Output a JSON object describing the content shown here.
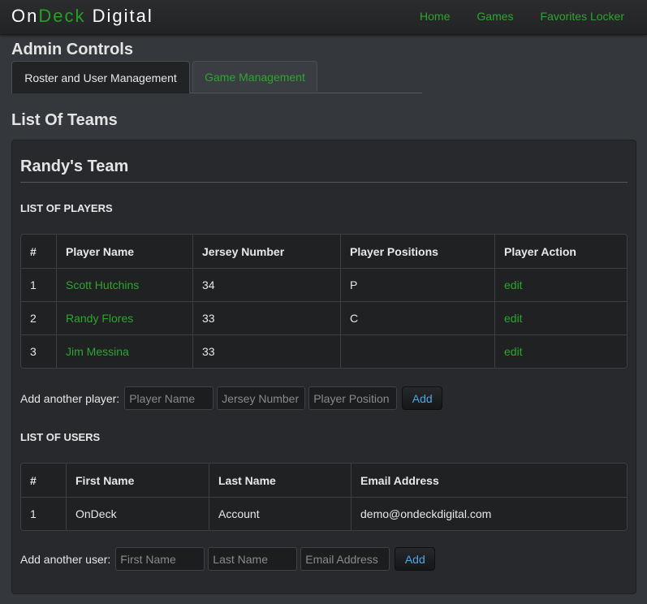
{
  "brand": {
    "part1": "On",
    "part2": "Deck",
    "part3": "Digital"
  },
  "nav": {
    "home": "Home",
    "games": "Games",
    "favorites": "Favorites Locker"
  },
  "admin": {
    "title": "Admin Controls",
    "tabs": [
      {
        "label": "Roster and User Management",
        "active": true
      },
      {
        "label": "Game Management",
        "active": false
      }
    ]
  },
  "list_title": "List Of Teams",
  "team": {
    "name": "Randy's Team",
    "players_label": "LIST OF PLAYERS",
    "players_headers": [
      "#",
      "Player Name",
      "Jersey Number",
      "Player Positions",
      "Player Action"
    ],
    "players": [
      {
        "num": "1",
        "name": "Scott Hutchins",
        "jersey": "34",
        "positions": "P",
        "action": "edit"
      },
      {
        "num": "2",
        "name": "Randy Flores",
        "jersey": "33",
        "positions": "C",
        "action": "edit"
      },
      {
        "num": "3",
        "name": "Jim Messina",
        "jersey": "33",
        "positions": "",
        "action": "edit"
      }
    ],
    "add_player": {
      "label": "Add another player:",
      "name_placeholder": "Player Name",
      "jersey_placeholder": "Jersey Number",
      "position_placeholder": "Player Position",
      "button": "Add"
    },
    "users_label": "LIST OF USERS",
    "users_headers": [
      "#",
      "First Name",
      "Last Name",
      "Email Address"
    ],
    "users": [
      {
        "num": "1",
        "first": "OnDeck",
        "last": "Account",
        "email": "demo@ondeckdigital.com"
      }
    ],
    "add_user": {
      "label": "Add another user:",
      "first_placeholder": "First Name",
      "last_placeholder": "Last Name",
      "email_placeholder": "Email Address",
      "button": "Add"
    }
  },
  "colors": {
    "accent_green": "#2ea52e",
    "button_blue": "#4ea7e6",
    "background": "#34373b"
  }
}
